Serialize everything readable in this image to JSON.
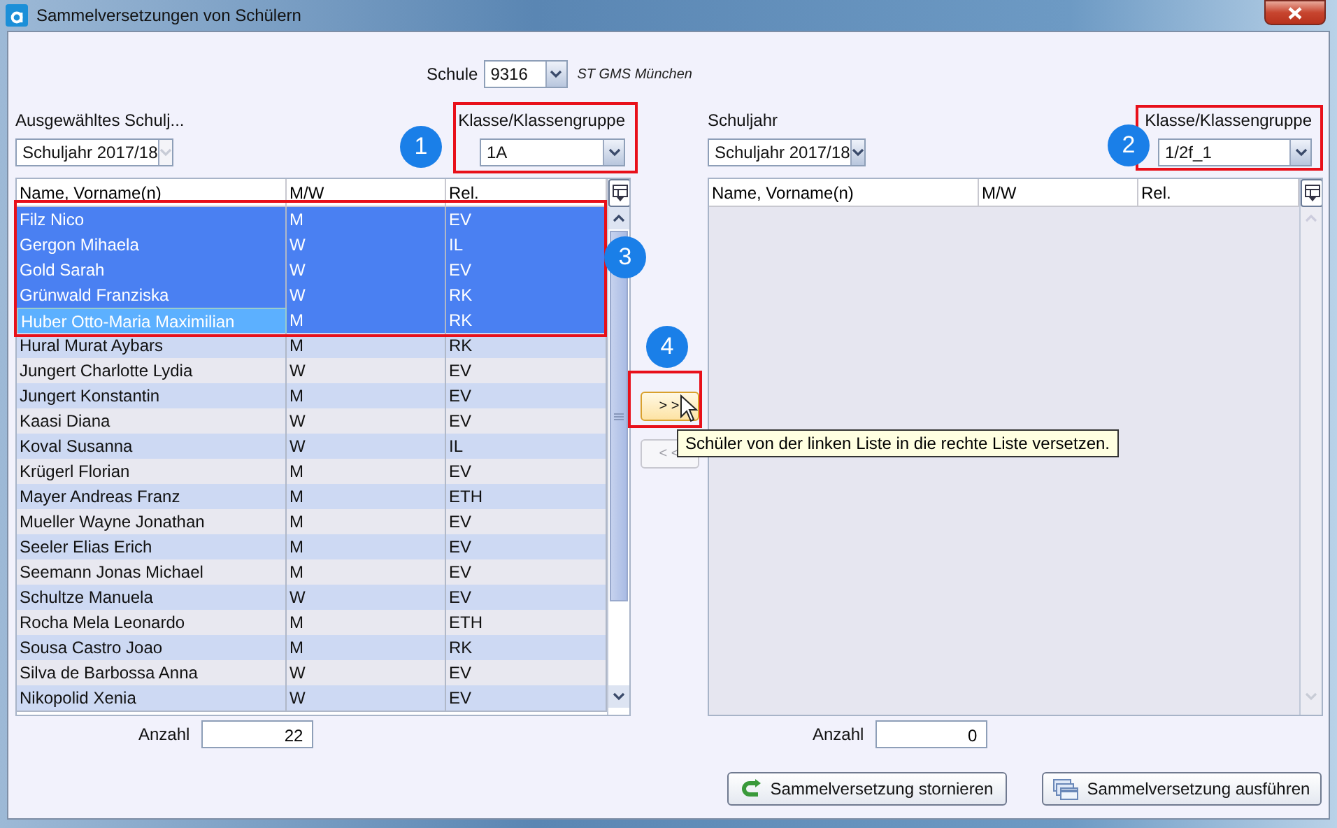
{
  "window": {
    "title": "Sammelversetzungen von Schülern"
  },
  "school": {
    "label": "Schule",
    "code": "9316",
    "name": "ST GMS München"
  },
  "left": {
    "year_label": "Ausgewähltes Schulj...",
    "year": "Schuljahr 2017/18",
    "year_disabled": true,
    "class_label": "Klasse/Klassengruppe",
    "class": "1A",
    "badge": "1",
    "columns": [
      "Name, Vorname(n)",
      "M/W",
      "Rel."
    ],
    "rows": [
      {
        "name": "Filz Nico",
        "gender": "M",
        "religion": "EV",
        "selected": true,
        "focused": false
      },
      {
        "name": "Gergon Mihaela",
        "gender": "W",
        "religion": "IL",
        "selected": true,
        "focused": false
      },
      {
        "name": "Gold Sarah",
        "gender": "W",
        "religion": "EV",
        "selected": true,
        "focused": false
      },
      {
        "name": "Grünwald Franziska",
        "gender": "W",
        "religion": "RK",
        "selected": true,
        "focused": false
      },
      {
        "name": "Huber Otto-Maria Maximilian",
        "gender": "M",
        "religion": "RK",
        "selected": true,
        "focused": true
      },
      {
        "name": "Hural Murat Aybars",
        "gender": "M",
        "religion": "RK",
        "selected": false,
        "focused": false
      },
      {
        "name": "Jungert Charlotte Lydia",
        "gender": "W",
        "religion": "EV",
        "selected": false,
        "focused": false
      },
      {
        "name": "Jungert Konstantin",
        "gender": "M",
        "religion": "EV",
        "selected": false,
        "focused": false
      },
      {
        "name": "Kaasi Diana",
        "gender": "W",
        "religion": "EV",
        "selected": false,
        "focused": false
      },
      {
        "name": "Koval Susanna",
        "gender": "W",
        "religion": "IL",
        "selected": false,
        "focused": false
      },
      {
        "name": "Krügerl Florian",
        "gender": "M",
        "religion": "EV",
        "selected": false,
        "focused": false
      },
      {
        "name": "Mayer Andreas Franz",
        "gender": "M",
        "religion": "ETH",
        "selected": false,
        "focused": false
      },
      {
        "name": "Mueller Wayne Jonathan",
        "gender": "M",
        "religion": "EV",
        "selected": false,
        "focused": false
      },
      {
        "name": "Seeler Elias Erich",
        "gender": "M",
        "religion": "EV",
        "selected": false,
        "focused": false
      },
      {
        "name": "Seemann Jonas Michael",
        "gender": "M",
        "religion": "EV",
        "selected": false,
        "focused": false
      },
      {
        "name": "Schultze Manuela",
        "gender": "W",
        "religion": "EV",
        "selected": false,
        "focused": false
      },
      {
        "name": "Rocha Mela Leonardo",
        "gender": "M",
        "religion": "ETH",
        "selected": false,
        "focused": false
      },
      {
        "name": "Sousa Castro Joao",
        "gender": "M",
        "religion": "RK",
        "selected": false,
        "focused": false
      },
      {
        "name": "Silva de Barbossa Anna",
        "gender": "W",
        "religion": "EV",
        "selected": false,
        "focused": false
      },
      {
        "name": "Nikopolid Xenia",
        "gender": "W",
        "religion": "EV",
        "selected": false,
        "focused": false
      }
    ],
    "count_label": "Anzahl",
    "count": "22"
  },
  "right": {
    "year_label": "Schuljahr",
    "year": "Schuljahr 2017/18",
    "year_disabled": false,
    "class_label": "Klasse/Klassengruppe",
    "class": "1/2f_1",
    "badge": "2",
    "columns": [
      "Name, Vorname(n)",
      "M/W",
      "Rel."
    ],
    "count_label": "Anzahl",
    "count": "0"
  },
  "selection_badge": "3",
  "transfer": {
    "badge": "4",
    "tooltip": "Schüler von der linken Liste in die rechte Liste versetzen.",
    "buttons": [
      {
        "label": "> >",
        "disabled": false,
        "hovered": true
      },
      {
        "label": "< <",
        "disabled": true,
        "hovered": false
      }
    ]
  },
  "actions": [
    {
      "label": "Sammelversetzung stornieren",
      "kind": "undo"
    },
    {
      "label": "Sammelversetzung ausführen",
      "kind": "execute"
    }
  ]
}
